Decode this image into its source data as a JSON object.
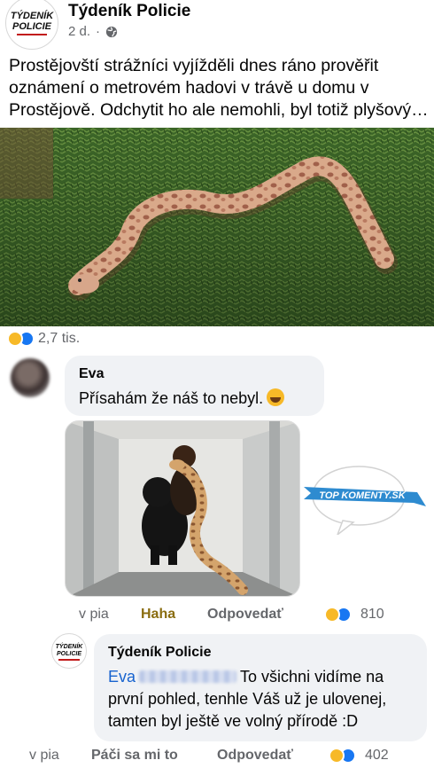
{
  "post": {
    "page_name": "Týdeník Policie",
    "time": "2 d.",
    "dot": "·",
    "privacy_icon": "globe-icon",
    "logo": {
      "line1": "TÝDENÍK",
      "line2": "POLICIE"
    },
    "text_lines": [
      "Prostějovští strážníci vyjížděli dnes ráno prověřit",
      "oznámení o metrovém hadovi v trávě u domu v",
      "Prostějově. Odchytit ho ale nemohli, byl totiž plyšový…"
    ],
    "reaction_icons": [
      "haha-icon",
      "like-icon"
    ],
    "reaction_count": "2,7 tis."
  },
  "comment1": {
    "author": "Eva",
    "text": "Přísahám že náš to nebyl.",
    "emoji": "laughing-emoji",
    "time": "v pia",
    "reaction_label": "Haha",
    "reply_label": "Odpovedať",
    "reaction_count": "810",
    "badge": {
      "line1": "TOP KOMENTY.SK"
    }
  },
  "reply1": {
    "author": "Týdeník Policie",
    "mention": "Eva",
    "body": "To všichni vidíme na první pohled, tenhle Váš už je ulovenej, tamten byl ještě ve volný přírodě :D",
    "time": "v pia",
    "like_label": "Páči sa mi to",
    "reply_label": "Odpovedať",
    "reaction_count": "402"
  },
  "colors": {
    "haha_yellow": "#f7b928",
    "like_blue": "#1877f2",
    "bubble_bg": "#f0f2f5",
    "mention_blue": "#1763cf",
    "secondary_text": "#65676b"
  }
}
